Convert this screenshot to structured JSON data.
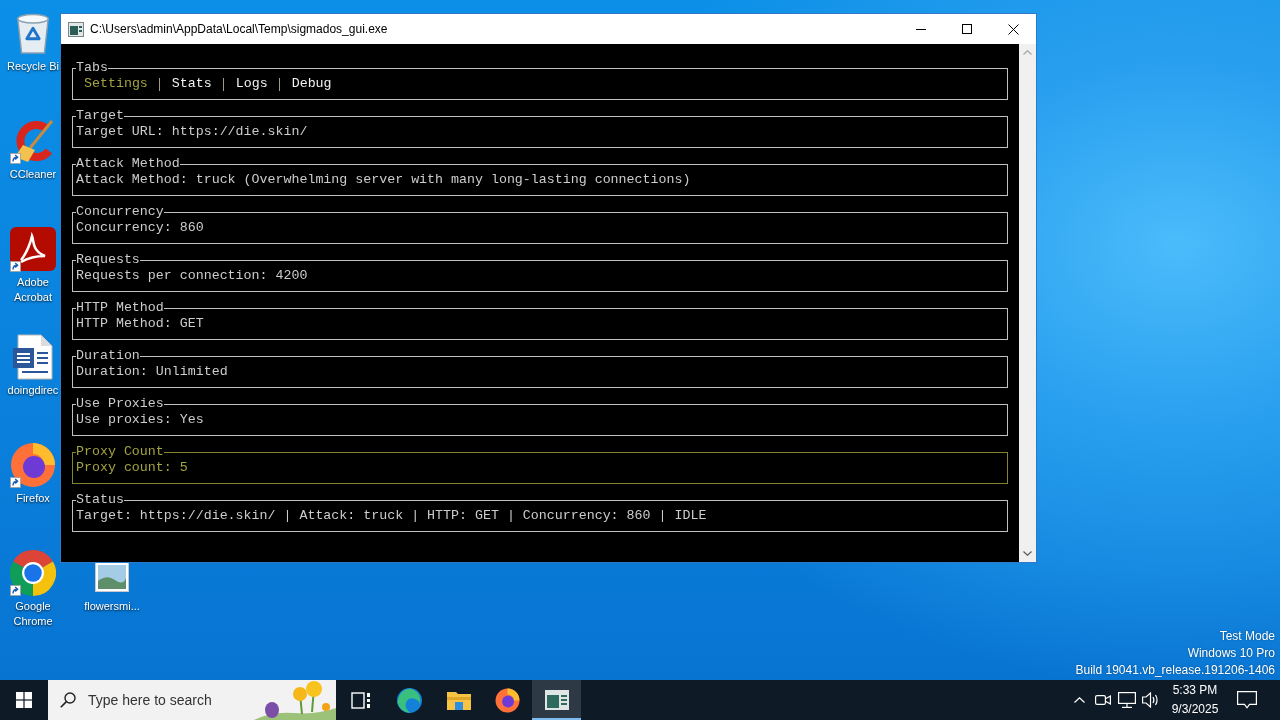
{
  "desktop": {
    "icons": [
      {
        "kind": "recycle-bin",
        "label": "Recycle Bi",
        "shortcut": false
      },
      {
        "kind": "cleaner",
        "label": "CCleaner",
        "shortcut": true
      },
      {
        "kind": "pdf",
        "label": "Adobe Acrobat",
        "shortcut": true
      },
      {
        "kind": "document",
        "label": "doingdirec",
        "shortcut": false
      },
      {
        "kind": "firefox",
        "label": "Firefox",
        "shortcut": true
      },
      {
        "kind": "chrome",
        "label": "Google Chrome",
        "shortcut": true
      },
      {
        "kind": "image",
        "label": "flowersmi...",
        "shortcut": false
      }
    ],
    "system_notice": [
      "Test Mode",
      "Windows 10 Pro",
      "Build 19041.vb_release.191206-1406"
    ]
  },
  "window": {
    "title": "C:\\Users\\admin\\AppData\\Local\\Temp\\sigmados_gui.exe",
    "tabs_panel": {
      "title": "Tabs",
      "focused": false,
      "tabs": [
        {
          "label": "Settings",
          "selected": true
        },
        {
          "label": "Stats",
          "selected": false
        },
        {
          "label": "Logs",
          "selected": false
        },
        {
          "label": "Debug",
          "selected": false
        }
      ]
    },
    "panels": [
      {
        "title": "Target",
        "text": "Target URL: https://die.skin/",
        "focused": false
      },
      {
        "title": "Attack Method",
        "text": "Attack Method: truck (Overwhelming server with many long-lasting connections)",
        "focused": false
      },
      {
        "title": "Concurrency",
        "text": "Concurrency: 860",
        "focused": false
      },
      {
        "title": "Requests",
        "text": "Requests per connection: 4200",
        "focused": false
      },
      {
        "title": "HTTP Method",
        "text": "HTTP Method: GET",
        "focused": false
      },
      {
        "title": "Duration",
        "text": "Duration: Unlimited",
        "focused": false
      },
      {
        "title": "Use Proxies",
        "text": "Use proxies: Yes",
        "focused": false
      },
      {
        "title": "Proxy Count",
        "text": "Proxy count: 5",
        "focused": true
      },
      {
        "title": "Status",
        "text": "Target: https://die.skin/ | Attack: truck | HTTP: GET | Concurrency: 860 | IDLE",
        "focused": false
      }
    ]
  },
  "taskbar": {
    "search": {
      "placeholder": "Type here to search"
    },
    "apps": [
      {
        "kind": "task-view",
        "active": false
      },
      {
        "kind": "edge",
        "active": false
      },
      {
        "kind": "folder",
        "active": false
      },
      {
        "kind": "firefox",
        "active": false
      },
      {
        "kind": "console",
        "active": true
      }
    ],
    "clock": {
      "time": "5:33 PM",
      "date": "9/3/2025"
    }
  }
}
